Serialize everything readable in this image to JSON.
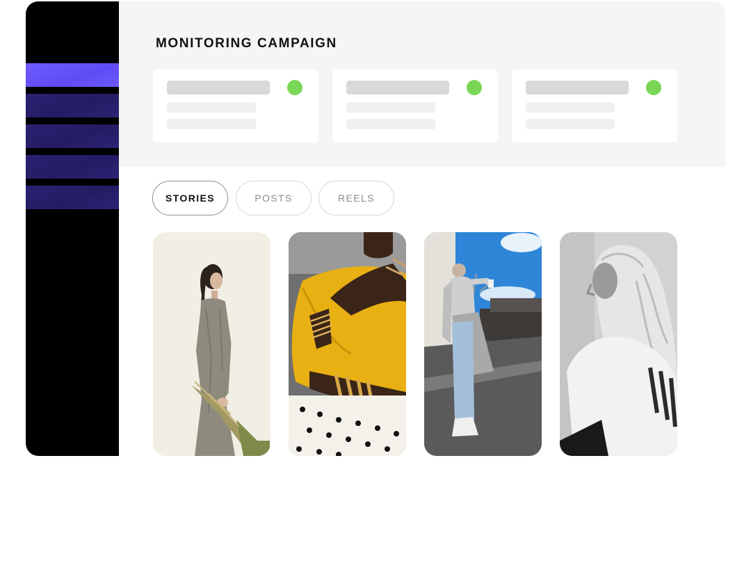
{
  "campaign": {
    "title": "MONITORING CAMPAIGN"
  },
  "tabs": [
    {
      "label": "STORIES",
      "active": true
    },
    {
      "label": "POSTS",
      "active": false
    },
    {
      "label": "REELS",
      "active": false
    }
  ],
  "colors": {
    "accent": "#6b5bff",
    "nav_item": "#2a2370",
    "status_ok": "#7ad756",
    "header_bg": "#f5f5f5"
  }
}
